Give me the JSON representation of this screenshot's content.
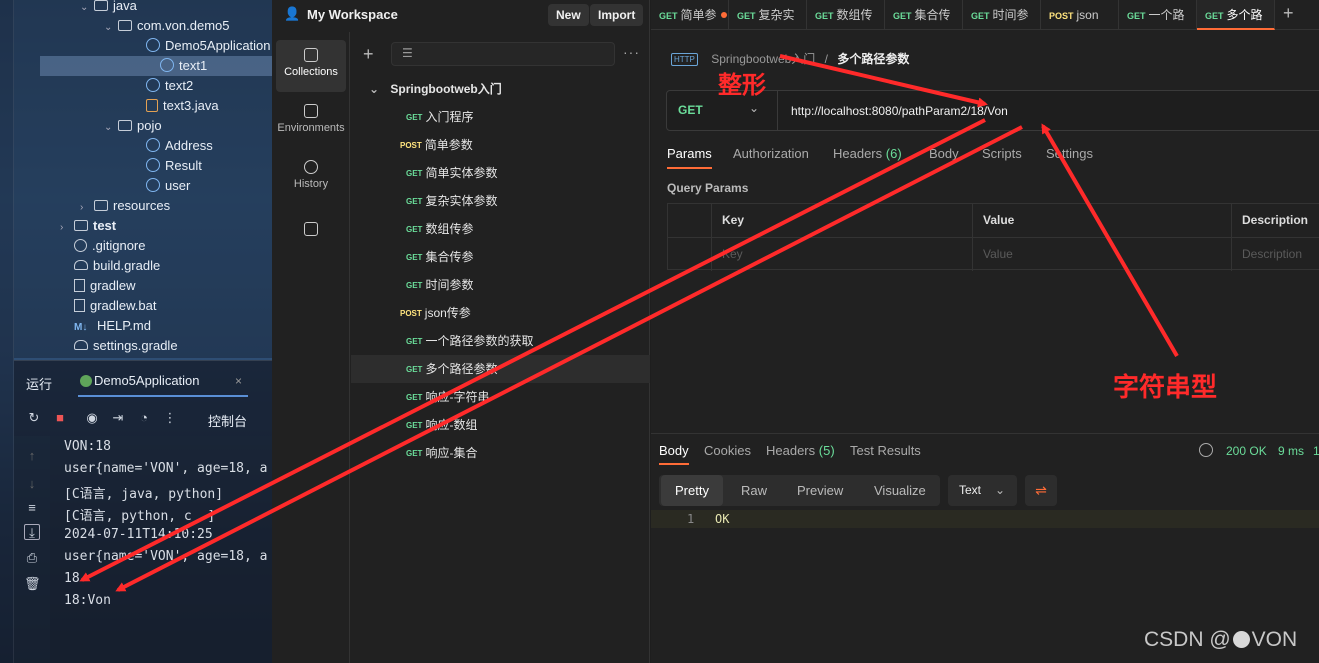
{
  "ide": {
    "tree": [
      {
        "label": "java",
        "kind": "folder",
        "indent": 0
      },
      {
        "label": "com.von.demo5",
        "kind": "package",
        "indent": 1
      },
      {
        "label": "Demo5Application",
        "kind": "class",
        "indent": 2
      },
      {
        "label": "text1",
        "kind": "class",
        "indent": 2,
        "selected": true
      },
      {
        "label": "text2",
        "kind": "class",
        "indent": 2
      },
      {
        "label": "text3.java",
        "kind": "java",
        "indent": 2
      },
      {
        "label": "pojo",
        "kind": "package",
        "indent": 1
      },
      {
        "label": "Address",
        "kind": "class",
        "indent": 2
      },
      {
        "label": "Result",
        "kind": "class",
        "indent": 2
      },
      {
        "label": "user",
        "kind": "class",
        "indent": 2
      },
      {
        "label": "resources",
        "kind": "folder",
        "indent": 0
      },
      {
        "label": "test",
        "kind": "folder",
        "indent": -1
      },
      {
        "label": ".gitignore",
        "kind": "git",
        "indent": -1
      },
      {
        "label": "build.gradle",
        "kind": "gradle",
        "indent": -1
      },
      {
        "label": "gradlew",
        "kind": "file",
        "indent": -1
      },
      {
        "label": "gradlew.bat",
        "kind": "file",
        "indent": -1
      },
      {
        "label": "HELP.md",
        "kind": "md",
        "indent": -1
      },
      {
        "label": "settings.gradle",
        "kind": "gradle",
        "indent": -1
      }
    ],
    "run_label": "运行",
    "run_tab": "Demo5Application",
    "console_label": "控制台",
    "console_lines": [
      "VON:18",
      "user{name='VON', age=18, a",
      "[C语言, java, python]",
      "[C语言, python, c  ]",
      "2024-07-11T14:10:25",
      "user{name='VON', age=18, a",
      "18",
      "18:Von"
    ]
  },
  "workspace": {
    "title": "My Workspace",
    "new_label": "New",
    "import_label": "Import"
  },
  "rail": [
    {
      "label": "Collections",
      "active": true
    },
    {
      "label": "Environments",
      "active": false
    },
    {
      "label": "History",
      "active": false
    },
    {
      "label": "",
      "active": false
    }
  ],
  "collection": {
    "name": "Springbootweb入门",
    "items": [
      {
        "method": "GET",
        "label": "入门程序"
      },
      {
        "method": "POST",
        "label": "简单参数"
      },
      {
        "method": "GET",
        "label": "简单实体参数"
      },
      {
        "method": "GET",
        "label": "复杂实体参数"
      },
      {
        "method": "GET",
        "label": "数组传参"
      },
      {
        "method": "GET",
        "label": "集合传参"
      },
      {
        "method": "GET",
        "label": "时间参数"
      },
      {
        "method": "POST",
        "label": "json传参"
      },
      {
        "method": "GET",
        "label": "一个路径参数的获取"
      },
      {
        "method": "GET",
        "label": "多个路径参数",
        "selected": true
      },
      {
        "method": "GET",
        "label": "响应-字符串"
      },
      {
        "method": "GET",
        "label": "响应-数组"
      },
      {
        "method": "GET",
        "label": "响应-集合"
      }
    ]
  },
  "tabs": [
    {
      "method": "GET",
      "label": "简单参",
      "dirty": true
    },
    {
      "method": "GET",
      "label": "复杂实"
    },
    {
      "method": "GET",
      "label": "数组传"
    },
    {
      "method": "GET",
      "label": "集合传"
    },
    {
      "method": "GET",
      "label": "时间参"
    },
    {
      "method": "POST",
      "label": "json"
    },
    {
      "method": "GET",
      "label": "一个路"
    },
    {
      "method": "GET",
      "label": "多个路",
      "active": true
    }
  ],
  "request": {
    "breadcrumb_parent": "Springbootweb入门",
    "breadcrumb_sep": "/",
    "breadcrumb_current": "多个路径参数",
    "http_badge": "HTTP",
    "method": "GET",
    "url": "http://localhost:8080/pathParam2/18/Von",
    "tabs": [
      "Params",
      "Authorization",
      "Headers",
      "Body",
      "Scripts",
      "Settings"
    ],
    "headers_count": "(6)",
    "query_params_title": "Query Params",
    "columns": [
      "Key",
      "Value",
      "Description"
    ],
    "placeholders": [
      "Key",
      "Value",
      "Description"
    ]
  },
  "response": {
    "tabs": [
      "Body",
      "Cookies",
      "Headers",
      "Test Results"
    ],
    "headers_count": "(5)",
    "status": "200 OK",
    "time": "9 ms",
    "size": "1",
    "views": [
      "Pretty",
      "Raw",
      "Preview",
      "Visualize"
    ],
    "format": "Text",
    "line_number": "1",
    "body": "OK"
  },
  "annotations": {
    "integer": "整形",
    "string": "字符串型",
    "color": "#ff2a2a"
  },
  "watermark": {
    "prefix": "CSDN @",
    "suffix": "VON"
  }
}
